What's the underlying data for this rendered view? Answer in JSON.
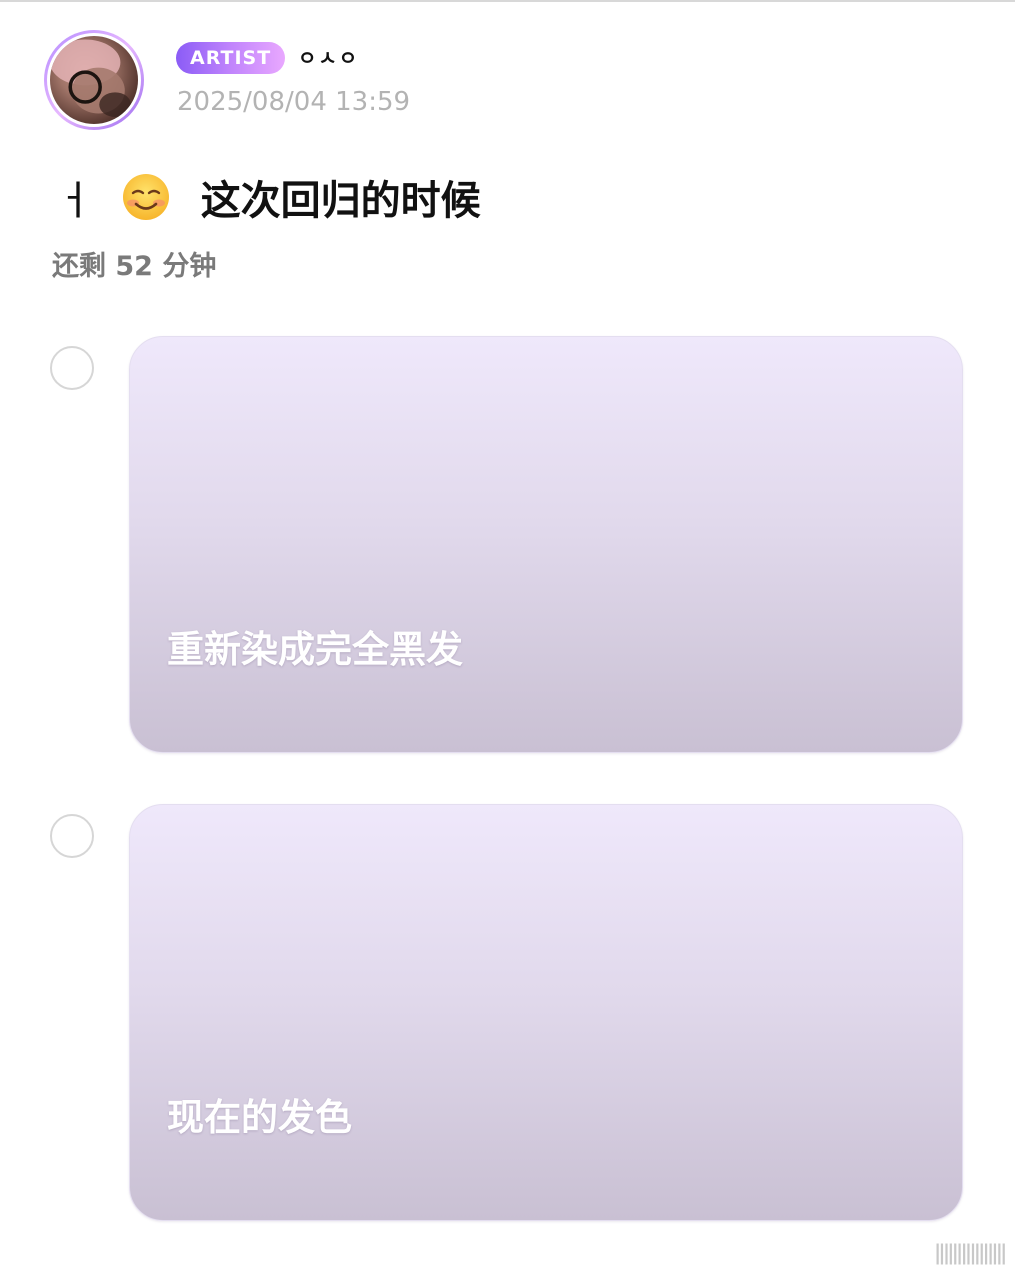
{
  "header": {
    "badge_label": "ARTIST",
    "username": "ㅇㅅㅇ",
    "timestamp": "2025/08/04 13:59"
  },
  "post": {
    "title_lead": "ㅓ",
    "title_emoji": "smiling-face-with-blushed-cheeks",
    "title_text": "这次回归的时候",
    "time_remaining": "还剩 52 分钟"
  },
  "poll": {
    "options": [
      {
        "label": "重新染成完全黑发",
        "selected": false
      },
      {
        "label": "现在的发色",
        "selected": false
      }
    ]
  },
  "watermark": "ǁǁǁǁǁǁǁǁ",
  "colors": {
    "badge_start": "#8b5cf6",
    "badge_end": "#e9a8ff",
    "card_top": "#efe8fb",
    "card_bottom": "#c9c0d3",
    "timestamp": "#b3b3b3"
  }
}
